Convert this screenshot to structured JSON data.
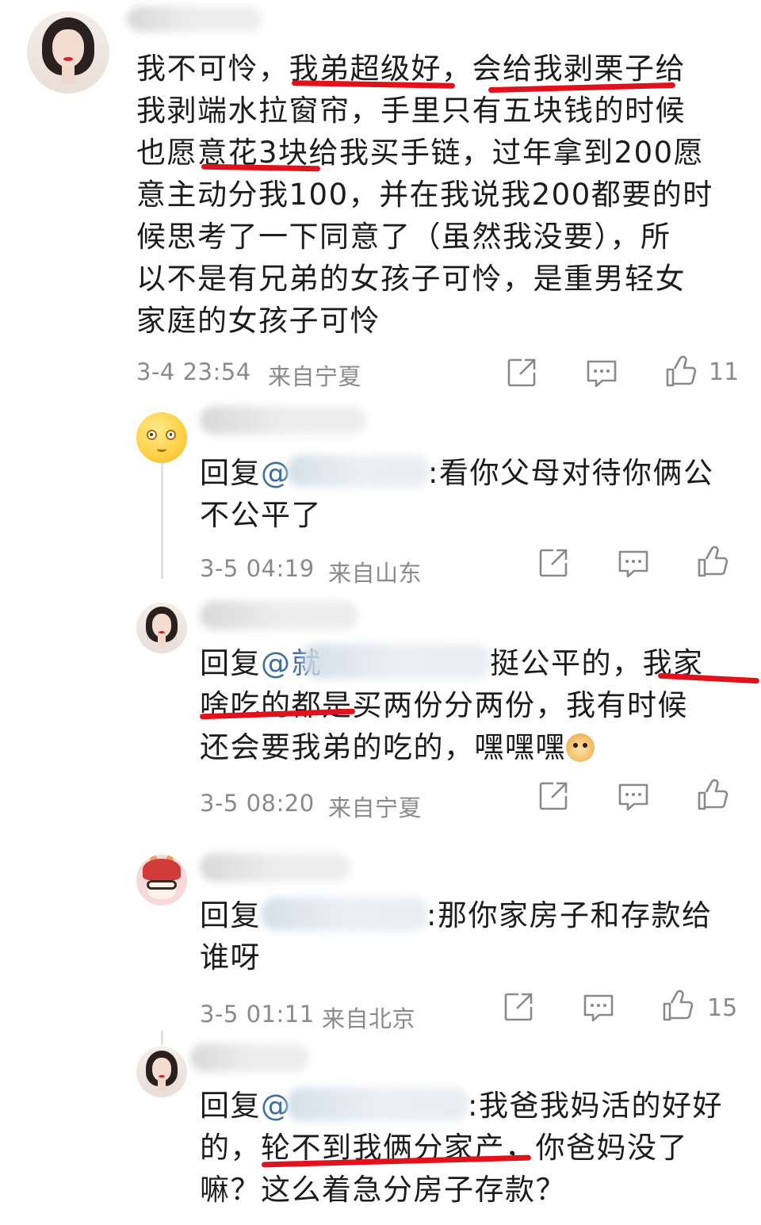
{
  "comments": [
    {
      "id": "main",
      "avatar": "woman-portrait",
      "text_lines": [
        "我不可怜，我弟超级好，会给我剥栗子给",
        "我剥端水拉窗帘，手里只有五块钱的时候",
        "也愿意花3块给我买手链，过年拿到200愿",
        "意主动分我100，并在我说我200都要的时",
        "候思考了一下同意了（虽然我没要），所",
        "以不是有兄弟的女孩子可怜，是重男轻女",
        "家庭的女孩子可怜"
      ],
      "timestamp": "3-4 23:54",
      "location": "来自宁夏",
      "likes": "11"
    },
    {
      "id": "reply1",
      "avatar": "yellow-emoji",
      "reply_prefix": "回复",
      "mention": "@",
      "line1_rest": ":看你父母对待你俩公",
      "text_lines": [
        "不公平了"
      ],
      "timestamp": "3-5 04:19",
      "location": "来自山东",
      "likes": ""
    },
    {
      "id": "reply2",
      "avatar": "woman-portrait",
      "reply_prefix": "回复",
      "mention": "@就",
      "line1_rest": "挺公平的，我家",
      "text_lines": [
        "啥吃的都是买两份分两份，我有时候",
        "还会要我弟的吃的，嘿嘿嘿"
      ],
      "emoji": "doge",
      "timestamp": "3-5 08:20",
      "location": "来自宁夏",
      "likes": ""
    },
    {
      "id": "reply3",
      "avatar": "cartoon-rabbit",
      "reply_prefix": "回复",
      "mention": "",
      "line1_rest": ":那你家房子和存款给",
      "text_lines": [
        "谁呀"
      ],
      "timestamp": "3-5 01:11",
      "location": "来自北京",
      "likes": "15"
    },
    {
      "id": "reply4",
      "avatar": "woman-portrait",
      "reply_prefix": "回复",
      "mention": "@",
      "line1_rest": ":我爸我妈活的好好",
      "text_lines": [
        "的，轮不到我俩分家产，你爸妈没了",
        "嘛？这么着急分房子存款？"
      ],
      "timestamp": "",
      "location": "",
      "likes": ""
    }
  ],
  "icons": {
    "share": "share-icon",
    "comment": "comment-icon",
    "like": "thumbs-up-icon"
  },
  "colors": {
    "mention": "#3f6f9e",
    "highlight": "#e0121b",
    "meta": "#8a8a8a"
  }
}
